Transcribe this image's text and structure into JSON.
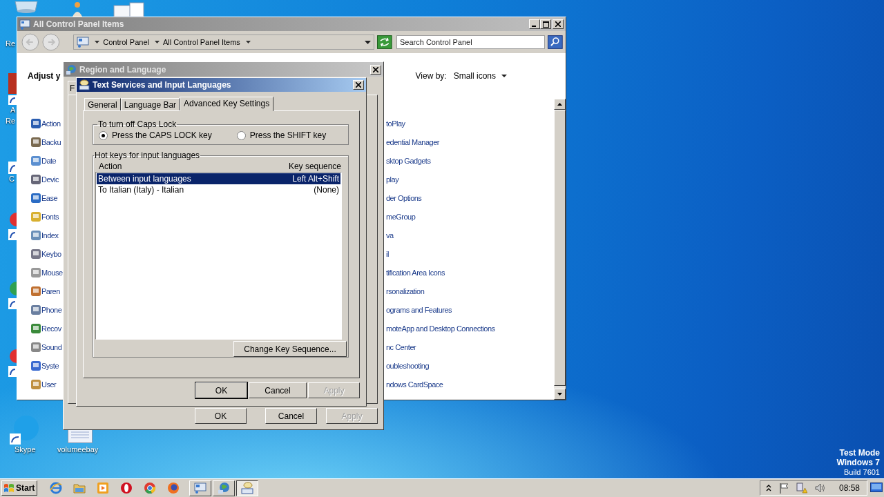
{
  "desktop": {
    "icons": [
      {
        "label": "Re"
      },
      {
        "label": "A"
      },
      {
        "label": "Re"
      },
      {
        "label": "C"
      },
      {
        "label": "Skype"
      },
      {
        "label": "volumeebay"
      }
    ],
    "os_notice": [
      "Test Mode",
      "Windows 7",
      "Build 7601"
    ]
  },
  "control_panel": {
    "title": "All Control Panel Items",
    "breadcrumb": [
      "Control Panel",
      "All Control Panel Items"
    ],
    "search": {
      "placeholder": "Search Control Panel"
    },
    "heading": "Adjust y",
    "view_by_label": "View by:",
    "view_by_value": "Small icons",
    "left_items": [
      "Action",
      "Backu",
      "Date",
      "Devic",
      "Ease",
      "Fonts",
      "Index",
      "Keybo",
      "Mouse",
      "Paren",
      "Phone",
      "Recov",
      "Sound",
      "Syste",
      "User"
    ],
    "right_items": [
      "toPlay",
      "edential Manager",
      "sktop Gadgets",
      "play",
      "der Options",
      "meGroup",
      "va",
      "il",
      "tification Area Icons",
      "rsonalization",
      "ograms and Features",
      "moteApp and Desktop Connections",
      "nc Center",
      "oubleshooting",
      "ndows CardSpace"
    ]
  },
  "region_dialog": {
    "title": "Region and Language",
    "tab_stub": "F",
    "buttons": [
      {
        "label": "OK",
        "disabled": false
      },
      {
        "label": "Cancel",
        "disabled": false
      },
      {
        "label": "Apply",
        "disabled": true
      }
    ]
  },
  "text_services": {
    "title": "Text Services and Input Languages",
    "tabs": [
      {
        "label": "General",
        "selected": false
      },
      {
        "label": "Language Bar",
        "selected": false
      },
      {
        "label": "Advanced Key Settings",
        "selected": true
      }
    ],
    "caps_group": {
      "title": "To turn off Caps Lock",
      "options": [
        {
          "label": "Press the CAPS LOCK key",
          "selected": true
        },
        {
          "label": "Press the SHIFT key",
          "selected": false
        }
      ]
    },
    "hotkeys": {
      "title": "Hot keys for input languages",
      "columns": [
        "Action",
        "Key sequence"
      ],
      "rows": [
        {
          "action": "Between input languages",
          "keys": "Left Alt+Shift",
          "selected": true
        },
        {
          "action": "To Italian (Italy) - Italian",
          "keys": "(None)",
          "selected": false
        }
      ],
      "change_button": "Change Key Sequence..."
    },
    "buttons": [
      {
        "label": "OK",
        "default": true,
        "disabled": false
      },
      {
        "label": "Cancel",
        "default": false,
        "disabled": false
      },
      {
        "label": "Apply",
        "default": false,
        "disabled": true
      }
    ]
  },
  "taskbar": {
    "start": "Start",
    "quick_launch": [
      {
        "kind": "ie"
      },
      {
        "kind": "folder"
      },
      {
        "kind": "media"
      },
      {
        "kind": "opera"
      },
      {
        "kind": "chrome"
      },
      {
        "kind": "firefox"
      }
    ],
    "windows": [
      {
        "kind": "control-panel",
        "pressed": false
      },
      {
        "kind": "globe",
        "pressed": false
      },
      {
        "kind": "keyboard",
        "pressed": true
      }
    ],
    "clock": "08:58"
  }
}
